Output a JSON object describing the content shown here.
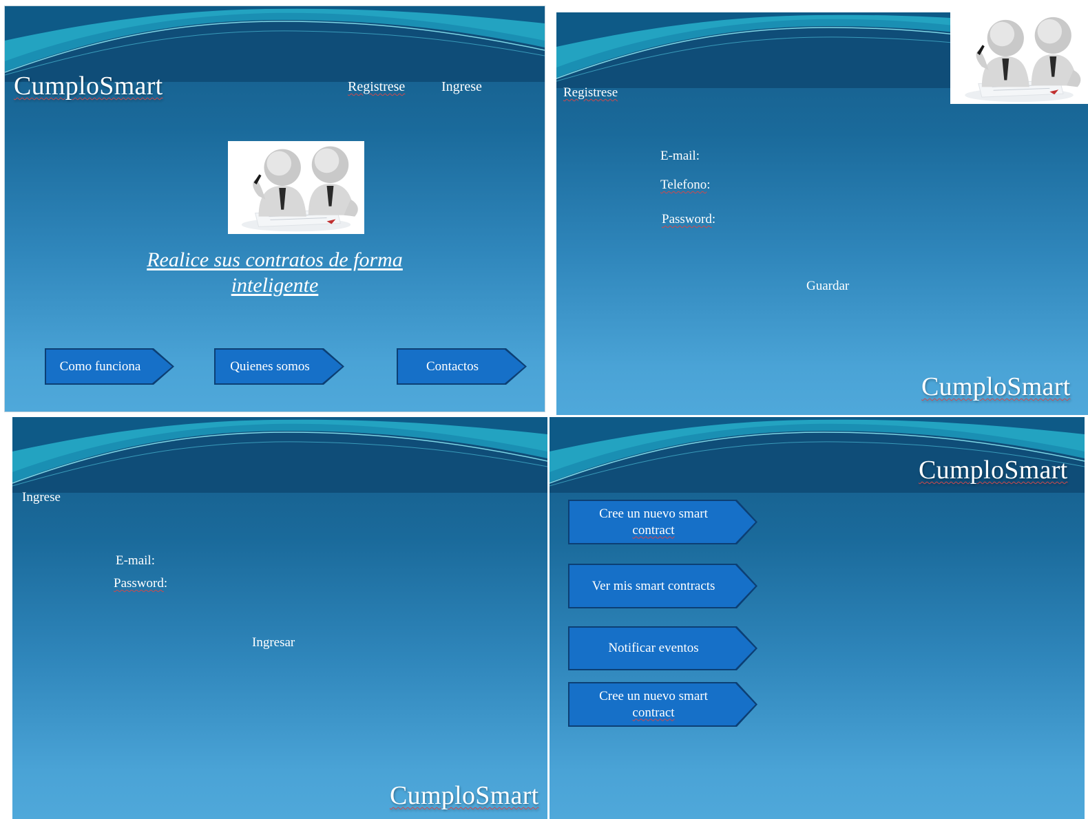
{
  "brand": "CumploSmart",
  "home": {
    "nav_register": "Registrese",
    "nav_login": "Ingrese",
    "tagline_line1": "Realice sus contratos de forma",
    "tagline_line2": "inteligente",
    "buttons": [
      "Como funciona",
      "Quienes somos",
      "Contactos"
    ]
  },
  "register": {
    "title": "Registrese",
    "email_label": "E-mail:",
    "phone_label": "Telefono",
    "password_label": "Password",
    "colon": ":",
    "save_label": "Guardar"
  },
  "login": {
    "title": "Ingrese",
    "email_label": "E-mail:",
    "password_label": "Password",
    "colon": ":",
    "submit_label": "Ingresar"
  },
  "dashboard": {
    "buttons": [
      {
        "line1": "Cree un nuevo smart",
        "line2": "contract"
      },
      {
        "line1": "Ver mis smart contracts",
        "line2": ""
      },
      {
        "line1": "Notificar eventos",
        "line2": ""
      },
      {
        "line1": "Cree un nuevo smart",
        "line2": "contract"
      }
    ]
  },
  "colors": {
    "button_fill": "#1670c8",
    "button_border": "#0c3f74",
    "panel_top": "#155a86",
    "panel_bottom": "#4fa8da"
  }
}
